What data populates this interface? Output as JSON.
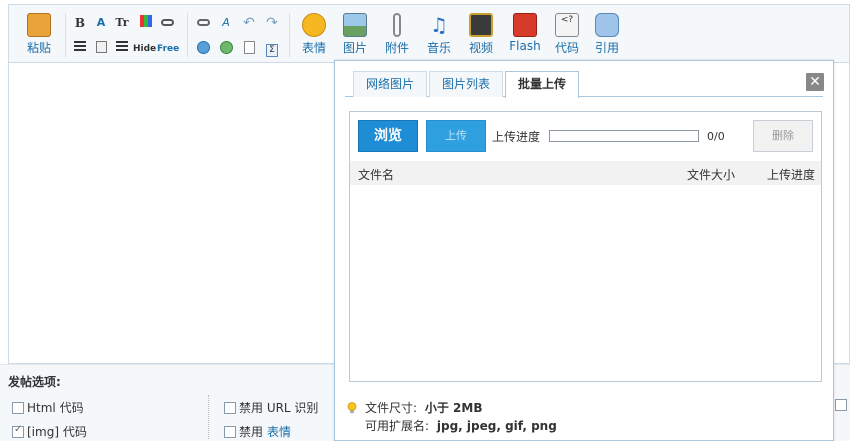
{
  "toolbar": {
    "paste_label": "粘贴",
    "small_bold": "B",
    "small_font": "A",
    "small_size": "Tr",
    "small_hide": "Hide",
    "small_free": "Free",
    "emoticon_label": "表情",
    "image_label": "图片",
    "attach_label": "附件",
    "music_label": "音乐",
    "video_label": "视频",
    "flash_label": "Flash",
    "code_label": "代码",
    "quote_label": "引用"
  },
  "options": {
    "title": "发帖选项:",
    "html_code": "Html 代码",
    "img_code": "[img] 代码",
    "disable_url": "禁用 URL 识别",
    "disable_prefix": "禁用",
    "disable_emoticon": "表情",
    "img_checked": true
  },
  "dialog": {
    "tabs": [
      {
        "label": "网络图片",
        "active": false
      },
      {
        "label": "图片列表",
        "active": false
      },
      {
        "label": "批量上传",
        "active": true
      }
    ],
    "close_symbol": "✕",
    "browse_label": "浏览",
    "upload_label": "上传",
    "progress_label": "上传进度",
    "progress_value": 0,
    "progress_count": "0/0",
    "delete_label": "删除",
    "columns": {
      "name": "文件名",
      "size": "文件大小",
      "progress": "上传进度"
    },
    "tips": {
      "size_prefix": "文件尺寸:",
      "size_value": "小于 2MB",
      "ext_prefix": "可用扩展名:",
      "ext_value": "jpg, jpeg, gif, png"
    }
  },
  "colors": {
    "accent": "#1e8dd6",
    "link": "#1a6ea8",
    "border": "#a8c6dd"
  }
}
